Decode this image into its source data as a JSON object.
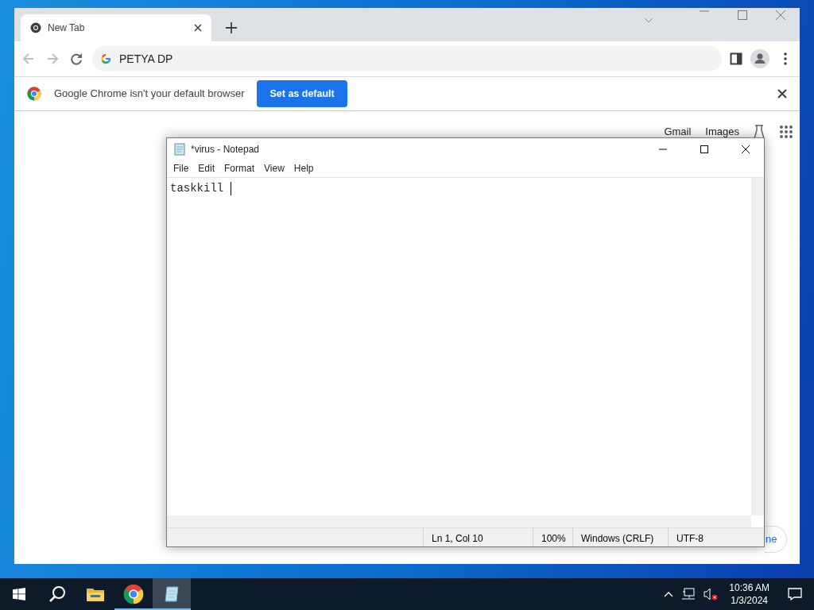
{
  "chrome": {
    "tabs": [
      {
        "title": "New Tab",
        "selected": true
      }
    ],
    "address": "PETYA DP",
    "infobar": {
      "message": "Google Chrome isn't your default browser",
      "button": "Set as default"
    },
    "page": {
      "links": [
        "Gmail",
        "Images"
      ],
      "customize_button": "ne"
    }
  },
  "notepad": {
    "title": "*virus - Notepad",
    "menu": [
      "File",
      "Edit",
      "Format",
      "View",
      "Help"
    ],
    "text": "taskkill ",
    "status": [
      "Ln 1, Col 10",
      "100%",
      "Windows (CRLF)",
      "UTF-8"
    ]
  },
  "taskbar": {
    "apps": [
      {
        "kind": "explorer",
        "running": false,
        "selected": false
      },
      {
        "kind": "chrome",
        "running": true,
        "selected": false
      },
      {
        "kind": "notepad",
        "running": true,
        "selected": true
      }
    ],
    "time": "10:36 AM",
    "date": "1/3/2024"
  }
}
